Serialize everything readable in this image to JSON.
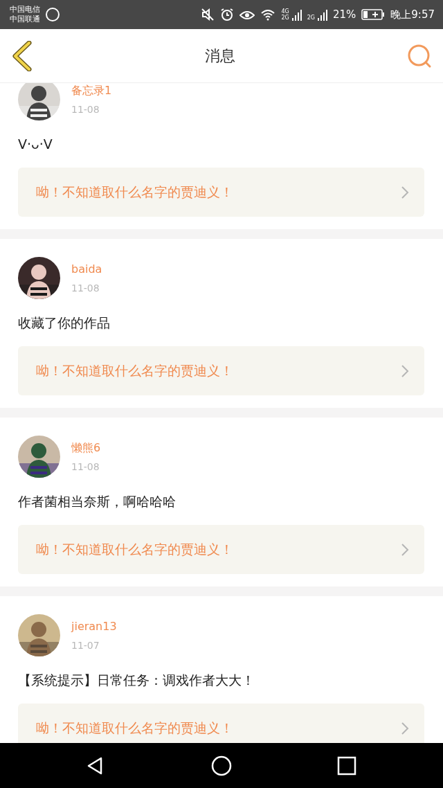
{
  "status_bar": {
    "carriers": [
      "中国电信",
      "中国联通"
    ],
    "network_labels": [
      "4G",
      "2G",
      "2G"
    ],
    "battery": "21%",
    "time": "晚上9:57"
  },
  "header": {
    "title": "消息"
  },
  "messages": [
    {
      "user": "备忘录1",
      "date": "11-08",
      "text": "V·ᴗ·V",
      "reply": "呦！不知道取什么名字的贾迪义！"
    },
    {
      "user": "baida",
      "date": "11-08",
      "text": "收藏了你的作品",
      "reply": "呦！不知道取什么名字的贾迪义！"
    },
    {
      "user": "懒熊6",
      "date": "11-08",
      "text": "作者菌相当奈斯，啊哈哈哈",
      "reply": "呦！不知道取什么名字的贾迪义！"
    },
    {
      "user": "jieran13",
      "date": "11-07",
      "text": "【系统提示】日常任务：调戏作者大大！",
      "reply": "呦！不知道取什么名字的贾迪义！"
    }
  ]
}
